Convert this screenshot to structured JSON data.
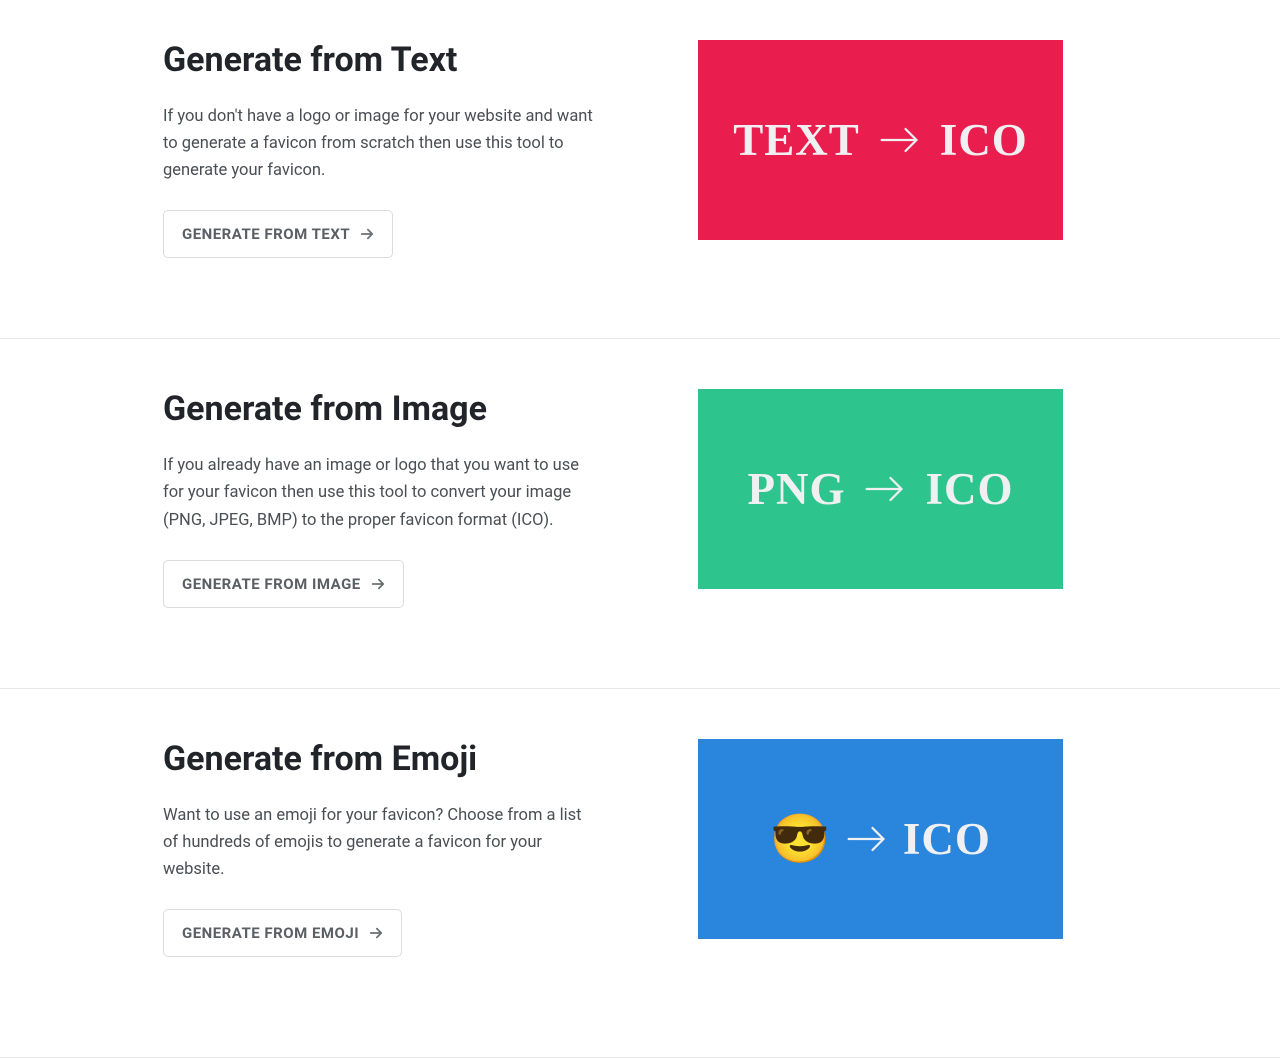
{
  "sections": [
    {
      "heading": "Generate from Text",
      "description": "If you don't have a logo or image for your website and want to generate a favicon from scratch then use this tool to generate your favicon.",
      "button_label": "GENERATE FROM TEXT",
      "visual_left": "TEXT",
      "visual_right": "ICO",
      "bg_color": "#e91e4e"
    },
    {
      "heading": "Generate from Image",
      "description": "If you already have an image or logo that you want to use for your favicon then use this tool to convert your image (PNG, JPEG, BMP) to the proper favicon format (ICO).",
      "button_label": "GENERATE FROM IMAGE",
      "visual_left": "PNG",
      "visual_right": "ICO",
      "bg_color": "#2ec48d"
    },
    {
      "heading": "Generate from Emoji",
      "description": "Want to use an emoji for your favicon? Choose from a list of hundreds of emojis to generate a favicon for your website.",
      "button_label": "GENERATE FROM EMOJI",
      "visual_emoji": "😎",
      "visual_right": "ICO",
      "bg_color": "#2a85dd"
    }
  ]
}
